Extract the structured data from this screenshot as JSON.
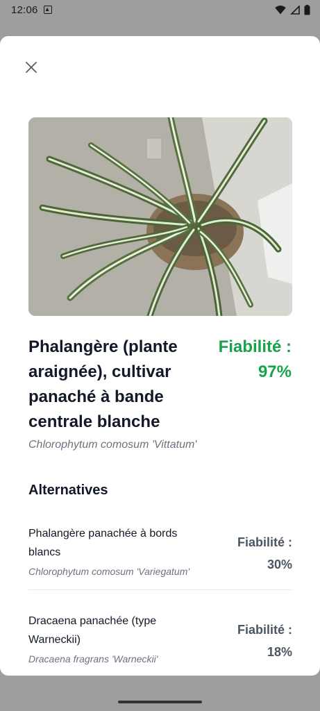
{
  "status_bar": {
    "time": "12:06",
    "icons": [
      "app-notification-icon",
      "wifi-icon",
      "signal-icon",
      "battery-icon"
    ]
  },
  "sheet": {
    "close_icon": "close-icon",
    "photo_alt": "spider-plant-photo",
    "main": {
      "name": "Phalangère (plante araignée), cultivar panaché à bande centrale blanche",
      "confidence": "Fiabilité : 97%",
      "scientific": "Chlorophytum comosum 'Vittatum'"
    },
    "alternatives_heading": "Alternatives",
    "alternatives": [
      {
        "name": "Phalangère panachée à bords blancs",
        "scientific": "Chlorophytum comosum 'Variegatum'",
        "confidence": "Fiabilité : 30%"
      },
      {
        "name": "Dracaena panachée (type Warneckii)",
        "scientific": "Dracaena fragrans 'Warneckii'",
        "confidence": "Fiabilité : 18%"
      }
    ]
  },
  "colors": {
    "accent_green": "#16a34a",
    "title_text": "#111827",
    "secondary_text": "#6b7280",
    "scrim": "#9e9e9e"
  }
}
